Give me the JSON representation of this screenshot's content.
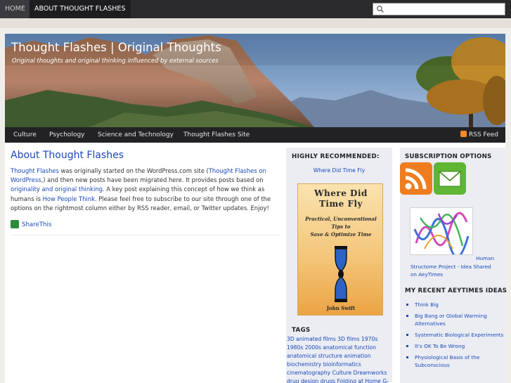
{
  "top_nav": {
    "home": "HOME",
    "about": "ABOUT THOUGHT FLASHES",
    "search_placeholder": ""
  },
  "header": {
    "title": "Thought Flashes | Original Thoughts",
    "description": "Original thoughts and original thinking influenced by external sources"
  },
  "cat_nav": {
    "items": [
      "Culture",
      "Psychology",
      "Science and Technology",
      "Thought Flashes Site"
    ],
    "rss": "RSS Feed"
  },
  "post": {
    "title": "About Thought Flashes",
    "p1_link1": "Thought Flashes",
    "p1_text1": " was originally started on the WordPress.com site (",
    "p1_link2": "Thought Flashes on WordPress",
    "p1_text2": ",) and then new posts have been migrated here.  It provides posts based on ",
    "p1_link3": "originality and original thinking",
    "p1_text3": ". A key post explaining this concept of how we think as humans is ",
    "p1_link4": "How People Think",
    "p1_text4": ". Please feel free to subscribe to our site through one of the options on the rightmost column either by RSS reader, email, or Twitter updates. Enjoy!",
    "share": "ShareThis"
  },
  "sidebar1": {
    "title": "HIGHLY RECOMMENDED:",
    "book_link": "Where Did Time Fly",
    "book": {
      "title_line1": "Where Did",
      "title_line2": "Time Fly",
      "sub1": "Practical, Unconventional",
      "sub2": "Tips to",
      "sub3": "Save & Optimize Time",
      "author": "John Swift"
    },
    "tags_title": "TAGS",
    "tags": "3D animated films 3D films 1970s 1980s 2000s anatomical function anatomical structure animation biochemistry bioinformatics cinematography Culture Dreamworks drug design drugs Folding at Home G-force high-resolution protein"
  },
  "sidebar2": {
    "subscription_title": "SUBSCRIPTION OPTIONS",
    "hsp_line1": "Human",
    "hsp_line2": "Structome Project - Idea Shared on AeyTimes",
    "recent_title": "MY RECENT AEYTIMES IDEAS",
    "recent_items": [
      "Think Big",
      "Big Bang or Global Warming Alternatives",
      "Systematic Biological Experiments",
      "It's OK To Be Wrong",
      "Physiological Basis of the Subconscious"
    ]
  },
  "colors": {
    "link": "#1a49b8",
    "nav_bg": "#2b2a2d",
    "rss_orange": "#ef7d20",
    "email_green": "#5fb534"
  }
}
